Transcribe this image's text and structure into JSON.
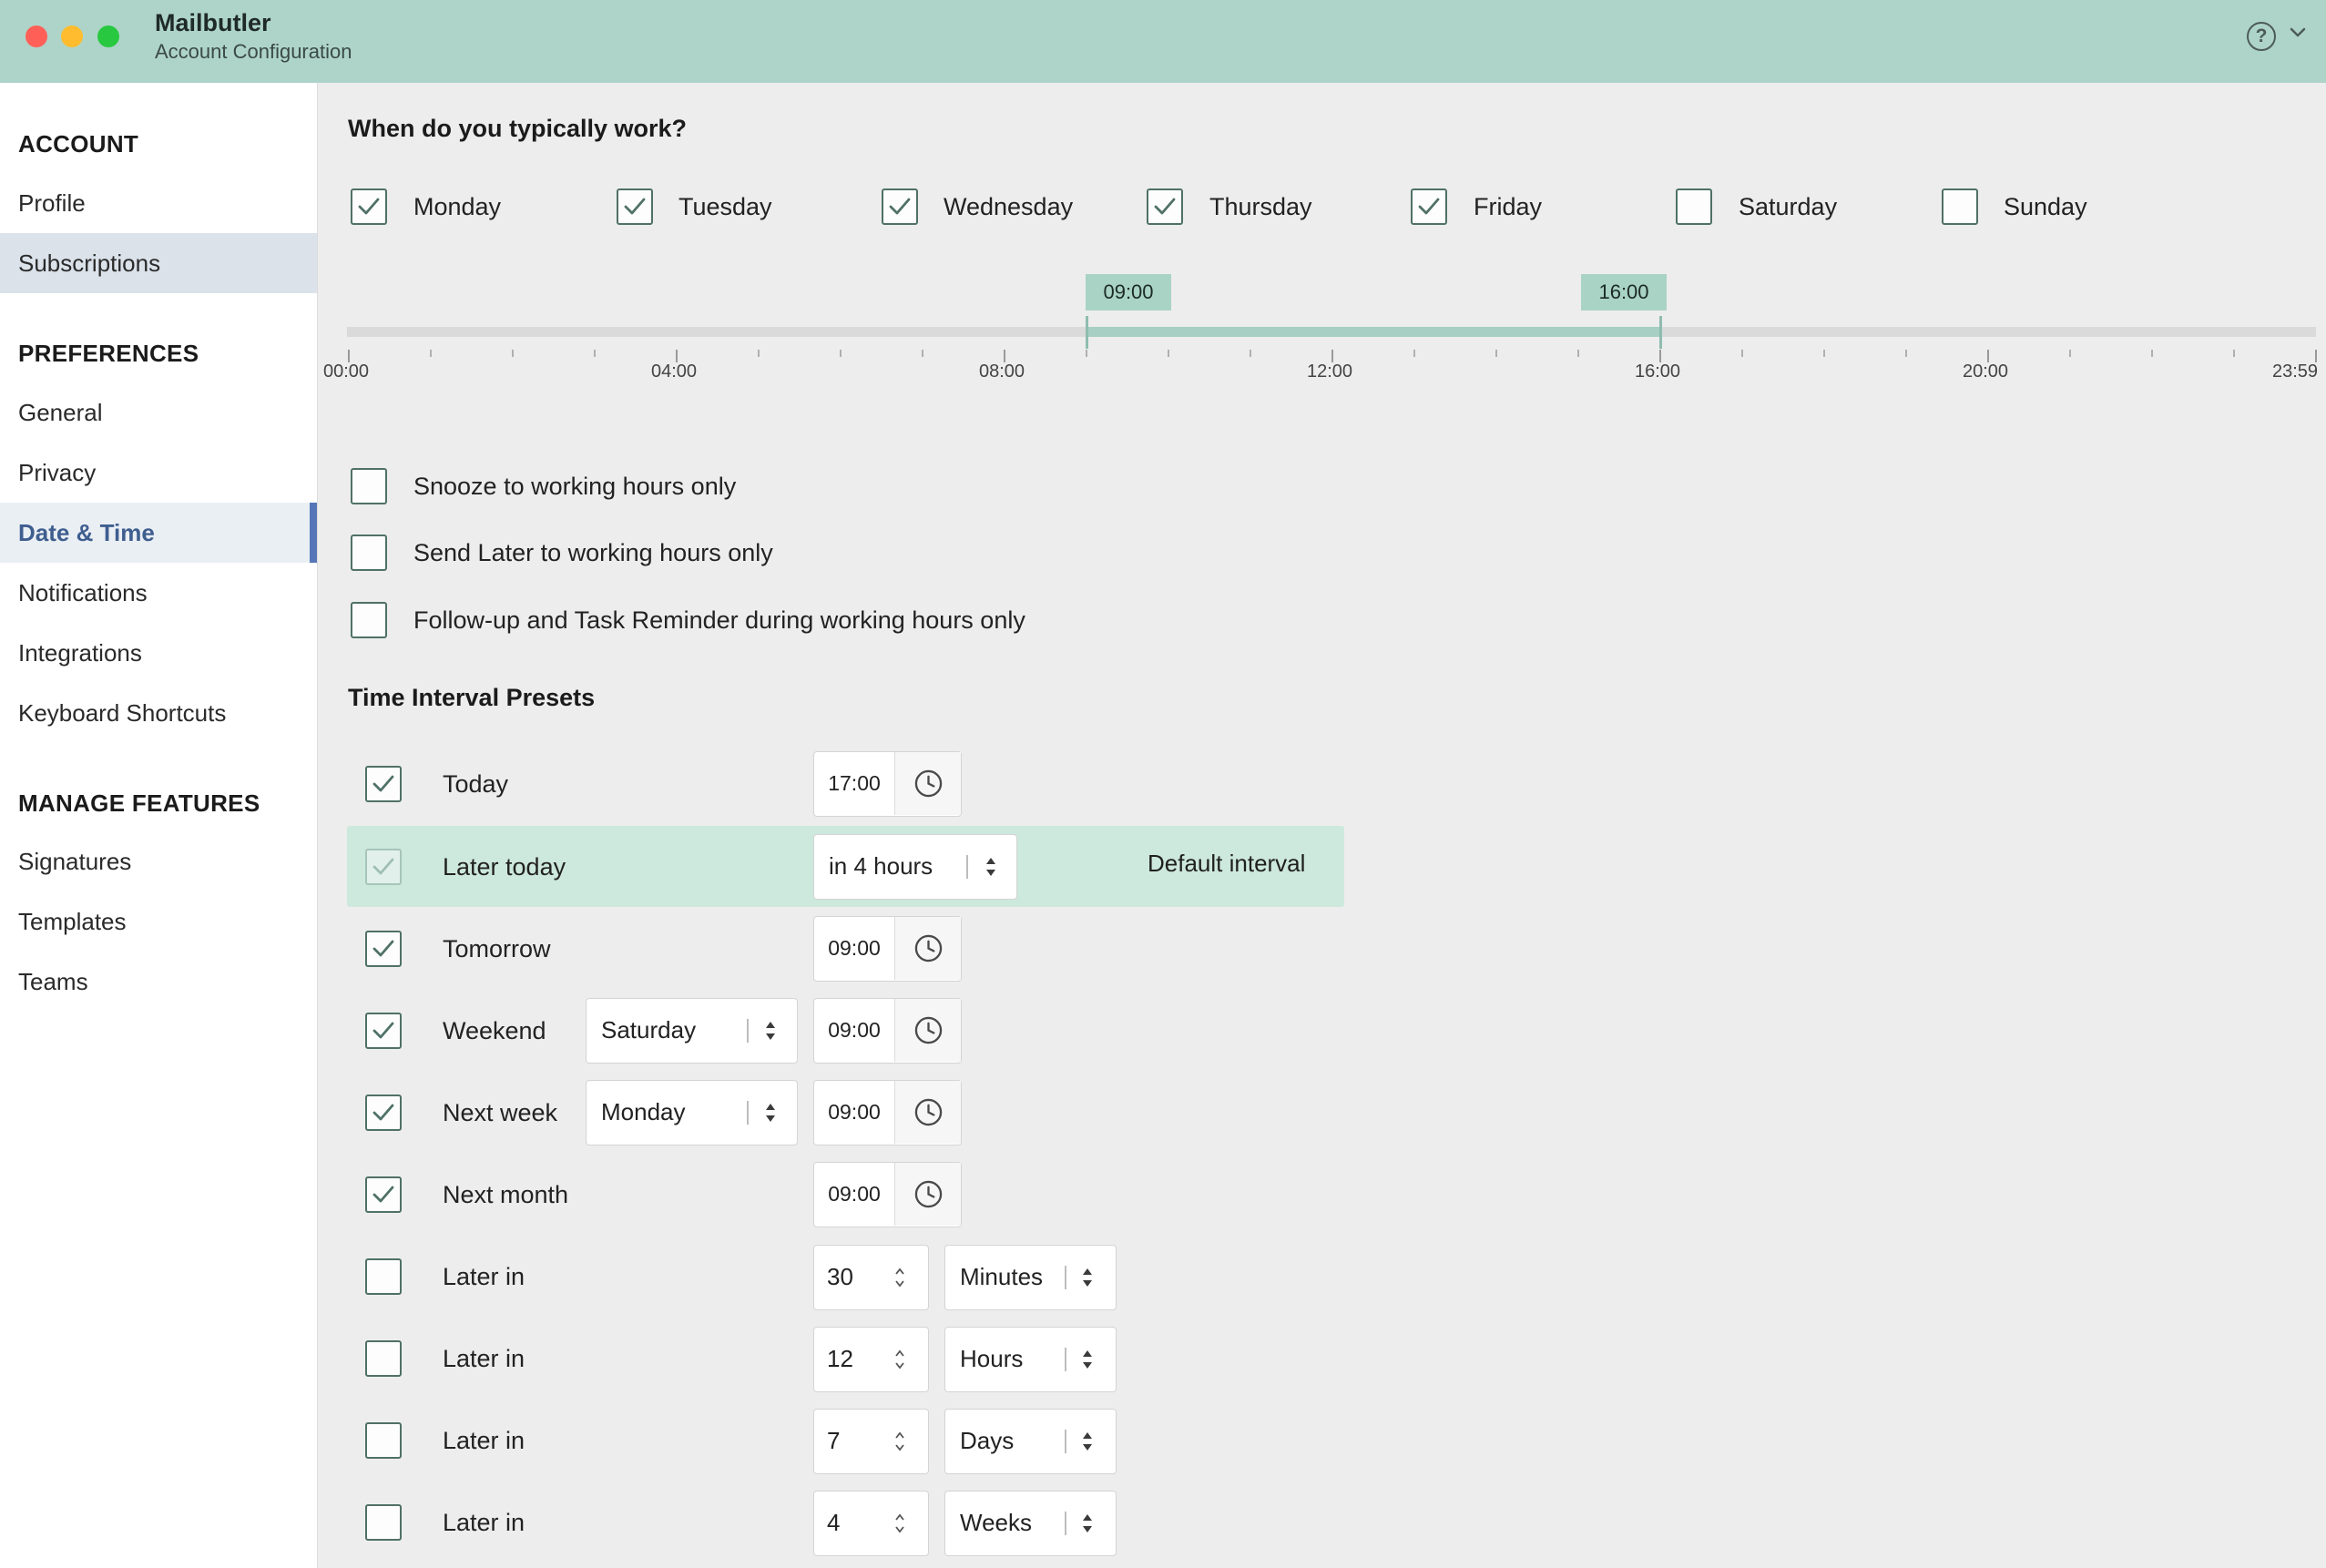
{
  "window": {
    "title": "Mailbutler",
    "subtitle": "Account Configuration"
  },
  "titlebar_icons": [
    "help-icon",
    "chevron-down-icon"
  ],
  "sidebar": {
    "sections": [
      {
        "title": "ACCOUNT",
        "items": [
          "Profile",
          "Subscriptions"
        ]
      },
      {
        "title": "PREFERENCES",
        "items": [
          "General",
          "Privacy",
          "Date & Time",
          "Notifications",
          "Integrations",
          "Keyboard Shortcuts"
        ]
      },
      {
        "title": "MANAGE FEATURES",
        "items": [
          "Signatures",
          "Templates",
          "Teams"
        ]
      }
    ],
    "highlighted_item": "Subscriptions",
    "active_item": "Date & Time"
  },
  "work": {
    "heading": "When do you typically work?",
    "days": [
      {
        "label": "Monday",
        "checked": true
      },
      {
        "label": "Tuesday",
        "checked": true
      },
      {
        "label": "Wednesday",
        "checked": true
      },
      {
        "label": "Thursday",
        "checked": true
      },
      {
        "label": "Friday",
        "checked": true
      },
      {
        "label": "Saturday",
        "checked": false
      },
      {
        "label": "Sunday",
        "checked": false
      }
    ],
    "slider": {
      "start": "09:00",
      "end": "16:00",
      "tick_labels": [
        "00:00",
        "04:00",
        "08:00",
        "12:00",
        "16:00",
        "20:00",
        "23:59"
      ]
    }
  },
  "options": [
    {
      "label": "Snooze to working hours only",
      "checked": false
    },
    {
      "label": "Send Later to working hours only",
      "checked": false
    },
    {
      "label": "Follow-up and Task Reminder during working hours only",
      "checked": false
    }
  ],
  "presets": {
    "heading": "Time Interval Presets",
    "default_label": "Default interval",
    "rows": [
      {
        "label": "Today",
        "checked": true,
        "time": "17:00"
      },
      {
        "label": "Later today",
        "checked": true,
        "select": "in 4 hours",
        "is_default": true
      },
      {
        "label": "Tomorrow",
        "checked": true,
        "time": "09:00"
      },
      {
        "label": "Weekend",
        "checked": true,
        "day": "Saturday",
        "time": "09:00"
      },
      {
        "label": "Next week",
        "checked": true,
        "day": "Monday",
        "time": "09:00"
      },
      {
        "label": "Next month",
        "checked": true,
        "time": "09:00"
      },
      {
        "label": "Later in",
        "checked": false,
        "number": "30",
        "unit": "Minutes"
      },
      {
        "label": "Later in",
        "checked": false,
        "number": "12",
        "unit": "Hours"
      },
      {
        "label": "Later in",
        "checked": false,
        "number": "7",
        "unit": "Days"
      },
      {
        "label": "Later in",
        "checked": false,
        "number": "4",
        "unit": "Weeks"
      }
    ]
  },
  "colors": {
    "titlebar": "#aed4c9",
    "accent": "#5577b7",
    "check": "#4f7167",
    "range": "#a8cfc3"
  }
}
